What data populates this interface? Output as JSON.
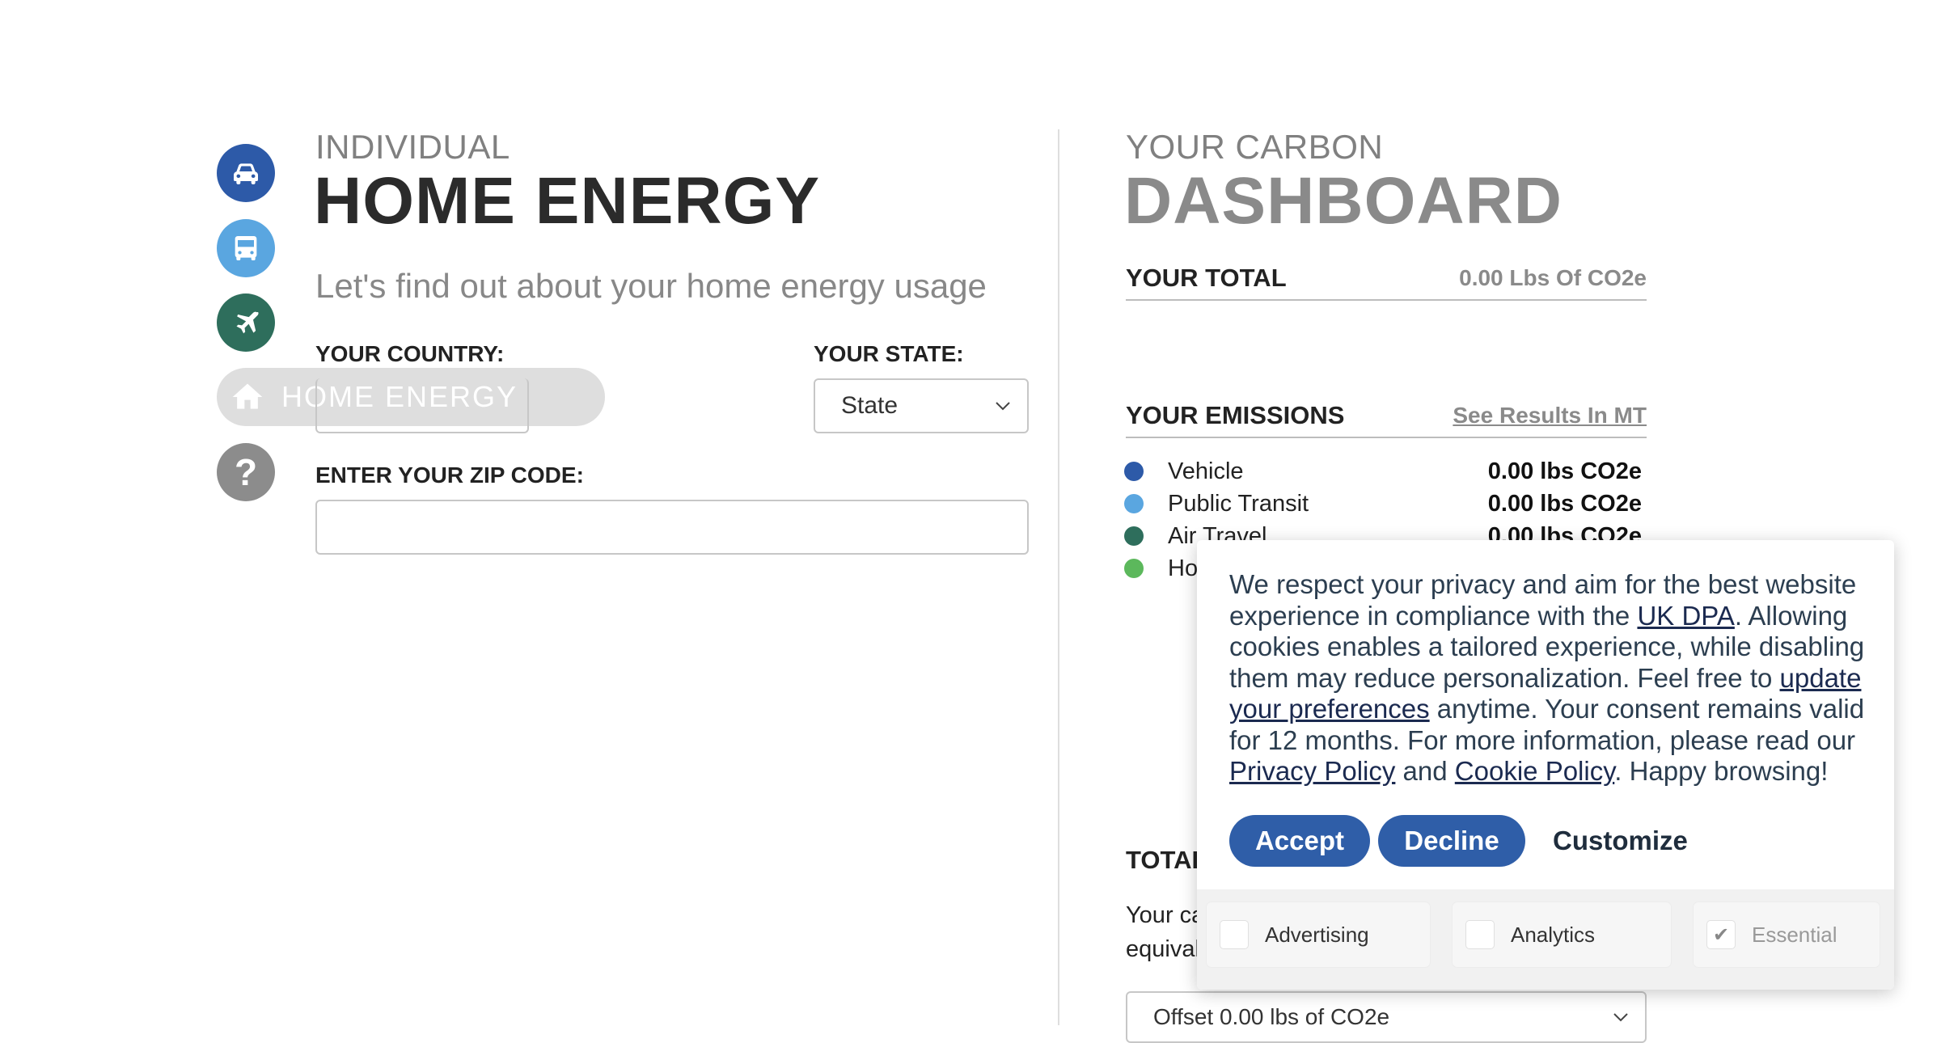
{
  "nav": {
    "home_energy_label": "HOME ENERGY",
    "colors": {
      "vehicle": "#2d5aa8",
      "transit": "#5aa6e0",
      "air": "#2e6e5c",
      "help": "#8c8c8c"
    }
  },
  "form": {
    "eyebrow": "INDIVIDUAL",
    "title": "HOME ENERGY",
    "subtitle": "Let's find out about your home energy usage",
    "country_label": "YOUR COUNTRY:",
    "state_label": "YOUR STATE:",
    "state_value": "State",
    "zip_label": "ENTER YOUR ZIP CODE:",
    "zip_value": ""
  },
  "dashboard": {
    "eyebrow": "YOUR CARBON",
    "title": "DASHBOARD",
    "total_label": "YOUR TOTAL",
    "total_value": "0.00 Lbs Of CO2e",
    "emissions_label": "YOUR EMISSIONS",
    "results_link": "See Results In MT",
    "emissions": [
      {
        "label": "Vehicle",
        "value": "0.00 lbs CO2e",
        "color": "#2d5aa8"
      },
      {
        "label": "Public Transit",
        "value": "0.00 lbs CO2e",
        "color": "#5aa6e0"
      },
      {
        "label": "Air Travel",
        "value": "0.00 lbs CO2e",
        "color": "#2e6e5c"
      },
      {
        "label": "Ho",
        "value": "",
        "color": "#5cb85c"
      }
    ],
    "total_section_label": "TOTAL",
    "total_text_line1": "Your ca",
    "total_text_line2": "equival",
    "offset_select": "Offset 0.00 lbs of CO2e"
  },
  "cookie": {
    "t1": "We respect your privacy and aim for the best website experience in compliance with the ",
    "link_dpa": "UK DPA",
    "t2": ". Allowing cookies enables a tailored experience, while disabling them may reduce personalization. Feel free to ",
    "link_prefs": "update your preferences",
    "t3": " anytime. Your consent remains valid for 12 months. For more information, please read our ",
    "link_privacy": "Privacy Policy",
    "t4": " and ",
    "link_cookie": "Cookie Policy",
    "t5": ". Happy browsing!",
    "accept": "Accept",
    "decline": "Decline",
    "customize": "Customize",
    "opt_advertising": "Advertising",
    "opt_analytics": "Analytics",
    "opt_essential": "Essential",
    "check_mark": "✔"
  }
}
